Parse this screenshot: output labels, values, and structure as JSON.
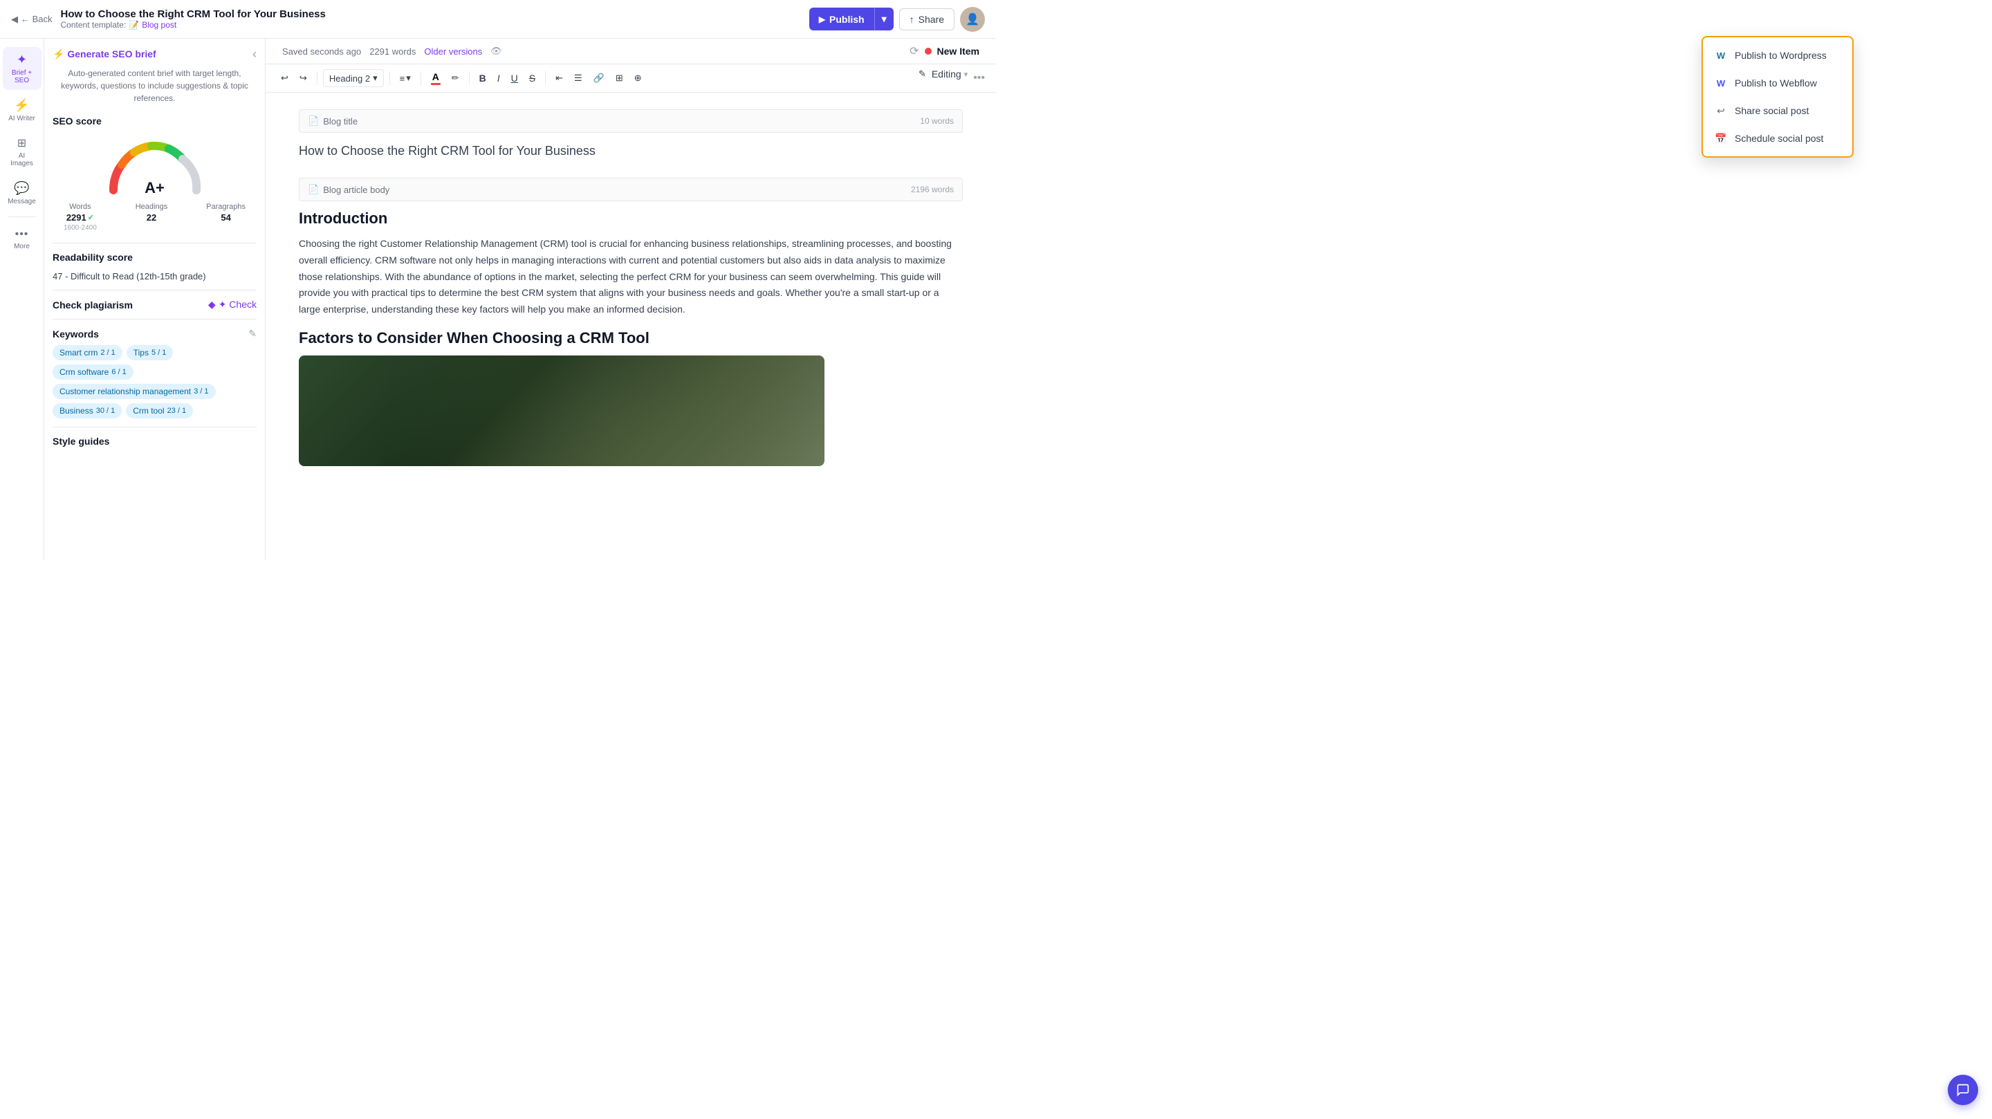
{
  "header": {
    "back_label": "← Back",
    "doc_title": "How to Choose the Right CRM Tool for Your Business",
    "template_prefix": "Content template:",
    "template_icon": "📝",
    "template_name": "Blog post",
    "publish_label": "Publish",
    "share_label": "Share"
  },
  "sidebar": {
    "items": [
      {
        "id": "brief-seo",
        "icon": "✦",
        "label": "Brief + SEO",
        "active": true
      },
      {
        "id": "ai-writer",
        "icon": "⚡",
        "label": "AI Writer",
        "active": false
      },
      {
        "id": "ai-images",
        "icon": "🖼",
        "label": "AI Images",
        "active": false
      },
      {
        "id": "message",
        "icon": "💬",
        "label": "Message",
        "active": false
      },
      {
        "id": "more",
        "icon": "•••",
        "label": "More",
        "active": false
      }
    ]
  },
  "brief_panel": {
    "generate_seo_label": "⚡ Generate SEO brief",
    "description": "Auto-generated content brief with target length, keywords, questions to include suggestions & topic references.",
    "seo_score_label": "SEO score",
    "gauge_score": "A+",
    "stats": {
      "words_label": "Words",
      "words_value": "2291",
      "words_check": "✓",
      "words_range": "1600-2400",
      "headings_label": "Headings",
      "headings_value": "22",
      "paragraphs_label": "Paragraphs",
      "paragraphs_value": "54"
    },
    "readability_label": "Readability score",
    "readability_value": "47 - Difficult to Read (12th-15th grade)",
    "plagiarism_label": "Check plagiarism",
    "check_label": "✦ Check",
    "keywords_label": "Keywords",
    "keywords": [
      {
        "text": "Smart crm",
        "count": "2 / 1"
      },
      {
        "text": "Tips",
        "count": "5 / 1"
      },
      {
        "text": "Crm software",
        "count": "6 / 1"
      },
      {
        "text": "Customer relationship management",
        "count": "3 / 1"
      },
      {
        "text": "Business",
        "count": "30 / 1"
      },
      {
        "text": "Crm tool",
        "count": "23 / 1"
      }
    ],
    "style_guides_label": "Style guides"
  },
  "editor_meta": {
    "saved_label": "Saved seconds ago",
    "word_count": "2291 words",
    "older_versions": "Older versions"
  },
  "toolbar": {
    "undo_label": "↩",
    "redo_label": "↪",
    "heading_label": "Heading 2",
    "align_label": "≡",
    "align_dropdown": "▾",
    "color_label": "A",
    "highlight_label": "✏",
    "bold_label": "B",
    "italic_label": "I",
    "underline_label": "U",
    "strikethrough_label": "S",
    "align_left_label": "⇤",
    "list_label": "☰",
    "link_label": "🔗",
    "image_label": "🖼",
    "more_label": "⊕"
  },
  "editor": {
    "block1_label": "Blog title",
    "block1_words": "10 words",
    "title_text": "How to Choose the Right CRM Tool for Your Business",
    "block2_label": "Blog article body",
    "block2_words": "2196 words",
    "heading1": "Introduction",
    "paragraph1": "Choosing the right Customer Relationship Management (CRM) tool is crucial for enhancing business relationships, streamlining processes, and boosting overall efficiency. CRM software not only helps in managing interactions with current and potential customers but also aids in data analysis to maximize those relationships. With the abundance of options in the market, selecting the perfect CRM for your business can seem overwhelming. This guide will provide you with practical tips to determine the best CRM system that aligns with your business needs and goals. Whether you're a small start-up or a large enterprise, understanding these key factors will help you make an informed decision.",
    "heading2": "Factors to Consider When Choosing a CRM Tool"
  },
  "right_sidebar": {
    "new_item_label": "New Item",
    "editing_label": "Editing",
    "chevron_down": "▾"
  },
  "dropdown_menu": {
    "items": [
      {
        "id": "publish-wordpress",
        "icon": "W",
        "label": "Publish to Wordpress"
      },
      {
        "id": "publish-webflow",
        "icon": "W",
        "label": "Publish to Webflow"
      },
      {
        "id": "share-social",
        "icon": "↩",
        "label": "Share social post"
      },
      {
        "id": "schedule-social",
        "icon": "📅",
        "label": "Schedule social post"
      }
    ]
  }
}
